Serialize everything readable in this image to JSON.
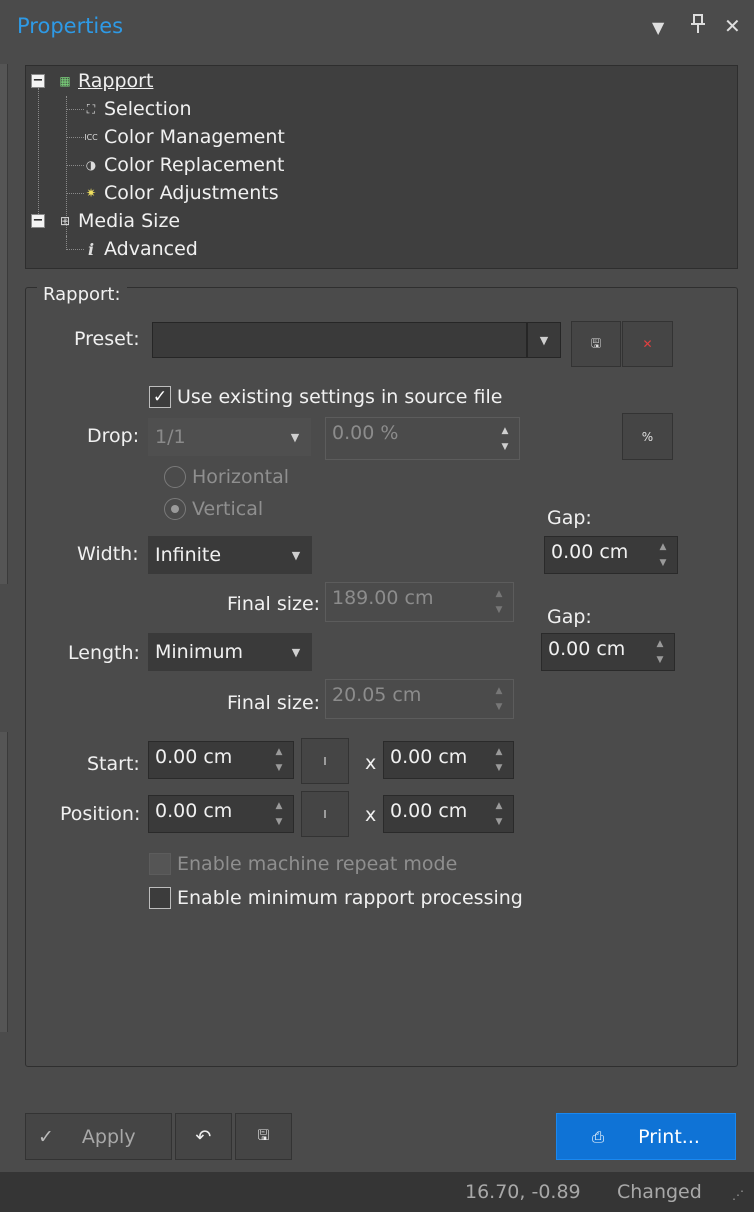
{
  "panel": {
    "title": "Properties"
  },
  "tree": {
    "rapport": "Rapport",
    "selection": "Selection",
    "color_management": "Color Management",
    "color_replacement": "Color Replacement",
    "color_adjustments": "Color Adjustments",
    "media_size": "Media Size",
    "advanced": "Advanced"
  },
  "rapport": {
    "group_label": "Rapport:",
    "preset_label": "Preset:",
    "preset_value": "",
    "use_existing": "Use existing settings in source file",
    "drop_label": "Drop:",
    "drop_value": "1/1",
    "drop_percent": "0.00 %",
    "percent_btn": "%",
    "horizontal": "Horizontal",
    "vertical": "Vertical",
    "gap_label": "Gap:",
    "width_gap": "0.00 cm",
    "length_gap": "0.00 cm",
    "width_label": "Width:",
    "width_value": "Infinite",
    "final_size_label": "Final size:",
    "width_final": "189.00 cm",
    "length_label": "Length:",
    "length_value": "Minimum",
    "length_final": "20.05 cm",
    "start_label": "Start:",
    "start_x": "0.00 cm",
    "start_y": "0.00 cm",
    "position_label": "Position:",
    "position_x": "0.00 cm",
    "position_y": "0.00 cm",
    "x_sep": "x",
    "machine_repeat": "Enable machine repeat mode",
    "min_rapport": "Enable minimum rapport processing"
  },
  "footer": {
    "apply": "Apply",
    "print": "Print..."
  },
  "status": {
    "coords": "16.70, -0.89",
    "state": "Changed"
  },
  "colors": {
    "accent": "#0f73d6",
    "title": "#2e9ae6"
  }
}
